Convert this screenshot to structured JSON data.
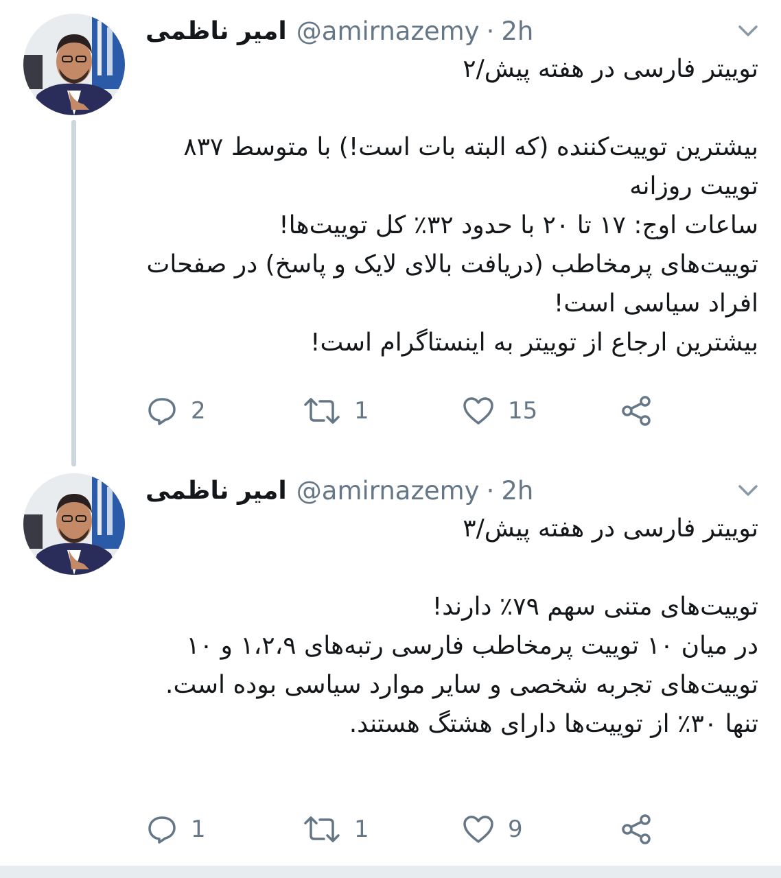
{
  "tweets": [
    {
      "display_name": "امیر ناظمی",
      "handle": "@amirnazemy",
      "separator": "·",
      "time": "2h",
      "avatar_icon": "profile-photo",
      "menu_icon": "chevron-down-icon",
      "text": "توییتر فارسی در هفته پیش/۲\n\nبیشترین توییت‌کننده (که البته بات است!) با متوسط ۸۳۷ توییت روزانه\nساعات اوج: ۱۷ تا ۲۰ با حدود ۳۲٪ کل توییت‌ها!\nتوییت‌های پرمخاطب (دریافت بالای لایک و پاسخ) در صفحات افراد سیاسی است!\nبیشترین ارجاع از توییتر به اینستاگرام است!",
      "replies": "2",
      "retweets": "1",
      "likes": "15"
    },
    {
      "display_name": "امیر ناظمی",
      "handle": "@amirnazemy",
      "separator": "·",
      "time": "2h",
      "avatar_icon": "profile-photo",
      "menu_icon": "chevron-down-icon",
      "text": "توییتر فارسی در هفته پیش/۳\n\nتوییت‌های متنی سهم ۷۹٪ دارند!\nدر میان ۱۰ توییت پرمخاطب فارسی رتبه‌های ۱،۲،۹ و ۱۰ توییت‌های تجربه شخصی و سایر موارد سیاسی بوده است.\nتنها ۳۰٪ از توییت‌ها دارای هشتگ هستند.",
      "replies": "1",
      "retweets": "1",
      "likes": "9"
    }
  ],
  "colors": {
    "text": "#14171a",
    "secondary": "#657786",
    "thread_line": "#ccd6dd",
    "divider": "#e6ecf0"
  }
}
